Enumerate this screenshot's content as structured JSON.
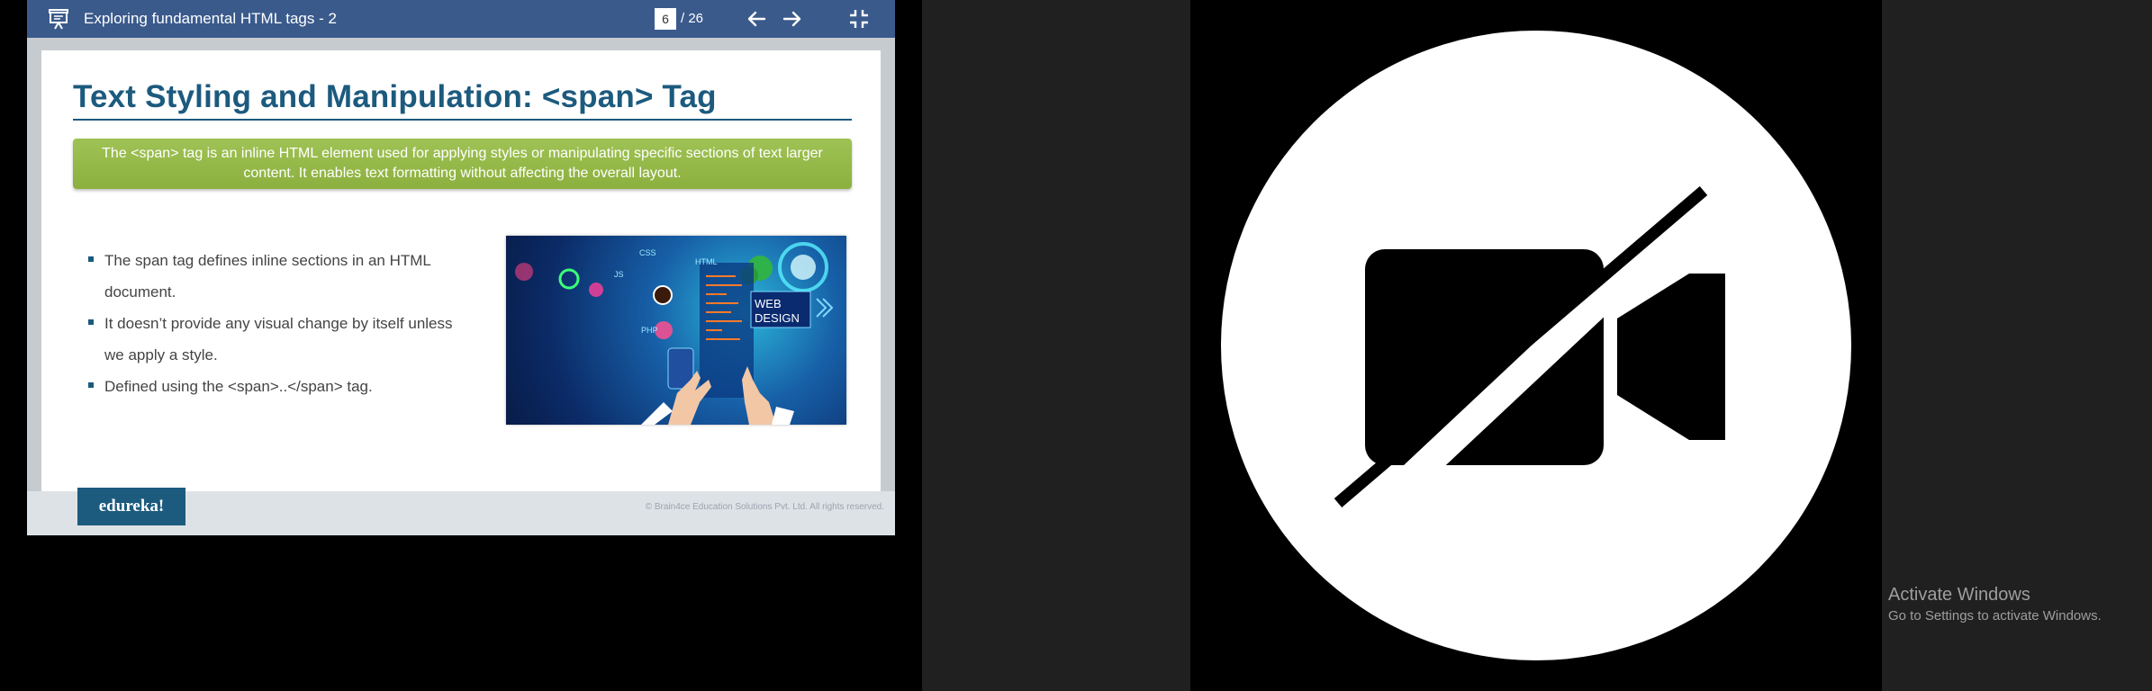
{
  "viewer": {
    "title": "Exploring fundamental HTML tags - 2",
    "current_page": "6",
    "page_total": "/ 26",
    "toolbar_color": "#3a5a8c"
  },
  "slide": {
    "title": "Text Styling and Manipulation: <span>  Tag",
    "intro": "The <span> tag is an inline HTML element used for applying styles or manipulating specific sections of text larger content. It enables text formatting without affecting the overall layout.",
    "bullets": [
      "The span tag defines inline sections in an HTML document.",
      "It doesn’t provide any visual change by itself unless we apply a style.",
      "Defined using the <span>..</span> tag."
    ],
    "image_labels": {
      "css": "CSS",
      "html": "HTML",
      "js": "JS",
      "php": "PHP",
      "web": "WEB",
      "design": "DESIGN"
    },
    "brand": "edureka!",
    "copyright": "© Brain4ce Education Solutions Pvt. Ltd. All rights reserved.",
    "title_color": "#1c5a7e",
    "intro_color": "#9fc255"
  },
  "camera": {
    "icon": "video-off-icon"
  },
  "watermark": {
    "title": "Activate Windows",
    "subtitle": "Go to Settings to activate Windows."
  }
}
